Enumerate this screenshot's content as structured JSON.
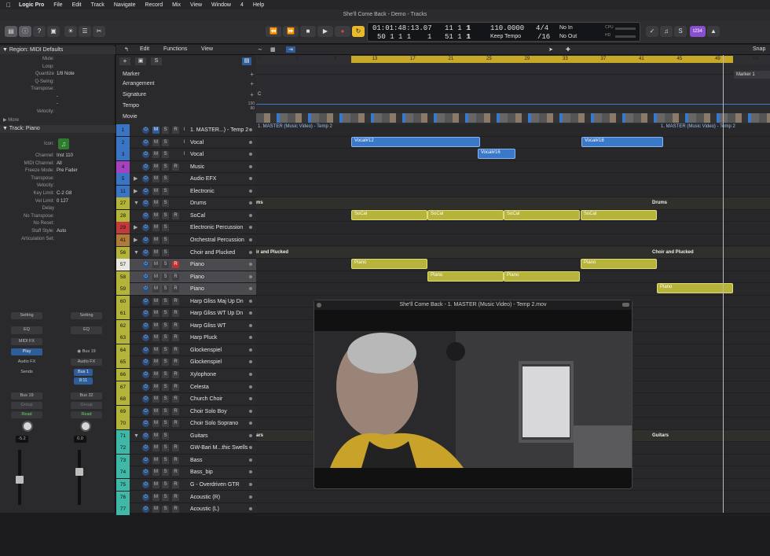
{
  "menubar": {
    "app": "Logic Pro",
    "items": [
      "File",
      "Edit",
      "Track",
      "Navigate",
      "Record",
      "Mix",
      "View",
      "Window",
      "4",
      "Help"
    ]
  },
  "window_title": "She'll Come Back - Demo - Tracks",
  "lcd": {
    "time": "01:01:48:13.07",
    "bars": "50 1 1 1",
    "sub1": "1",
    "pos2": "11 1 1",
    "sub2": "1",
    "pos3": "51 1 1",
    "sub3": "1",
    "tempo": "110.0000",
    "tempo_mode": "Keep Tempo",
    "sig": "4/4",
    "div": "/16",
    "in": "No In",
    "out": "No Out",
    "cpu": "CPU",
    "hd": "HD"
  },
  "toolbar": {
    "user": "t234"
  },
  "inspector": {
    "region_header": "Region: MIDI Defaults",
    "region_rows": [
      {
        "k": "Mute:",
        "v": ""
      },
      {
        "k": "Loop:",
        "v": ""
      },
      {
        "k": "Quantize",
        "v": "1/8 Note"
      },
      {
        "k": "Q-Swing:",
        "v": ""
      },
      {
        "k": "Transpose:",
        "v": ""
      },
      {
        "k": "",
        "v": "-"
      },
      {
        "k": "",
        "v": "-"
      },
      {
        "k": "Velocity:",
        "v": ""
      }
    ],
    "more": "More",
    "track_header": "Track:",
    "track_name": "Piano",
    "track_rows": [
      {
        "k": "Icon:",
        "v": ""
      },
      {
        "k": "Channel:",
        "v": "Inst 110"
      },
      {
        "k": "MIDI Channel:",
        "v": "All"
      },
      {
        "k": "Freeze Mode:",
        "v": "Pre Fader"
      },
      {
        "k": "Transpose:",
        "v": ""
      },
      {
        "k": "Velocity:",
        "v": ""
      },
      {
        "k": "Key Limit:",
        "v": "C-2  G8"
      },
      {
        "k": "Vel Limit:",
        "v": "0  127"
      },
      {
        "k": "Delay",
        "v": ""
      },
      {
        "k": "No Transpose:",
        "v": ""
      },
      {
        "k": "No Reset:",
        "v": ""
      },
      {
        "k": "Staff Style:",
        "v": "Auto"
      },
      {
        "k": "Articulation Set:",
        "v": ""
      }
    ],
    "strip1": {
      "setting": "Setting",
      "eq": "EQ",
      "midifx": "MIDI FX",
      "play": "Play",
      "audiofx": "Audio FX",
      "sends": "Sends",
      "output": "Bus 19",
      "group": "Group",
      "read": "Read",
      "vol": "-5.2"
    },
    "strip2": {
      "setting": "Setting",
      "eq": "EQ",
      "bus": "Bus 19",
      "audiofx": "Audio FX",
      "send1": "Bus 1",
      "send2": "8:11",
      "output": "Bus 32",
      "group": "Group",
      "read": "Read",
      "vol": "0.0"
    }
  },
  "tracks_menu": {
    "edit": "Edit",
    "functions": "Functions",
    "view": "View",
    "snap": "Snap"
  },
  "global_tracks": [
    "Marker",
    "Arrangement",
    "Signature",
    "Tempo",
    "Movie"
  ],
  "tempo_vals": [
    "130",
    "90"
  ],
  "signature_val": "C",
  "marker_label": "Marker 1",
  "ruler": [
    "1",
    "5",
    "9",
    "13",
    "17",
    "21",
    "25",
    "29",
    "33",
    "37",
    "41",
    "45",
    "49",
    "53"
  ],
  "tracks": [
    {
      "n": "1",
      "name": "1. MASTER...) - Temp 2",
      "color": "#3a74c4",
      "type": "video"
    },
    {
      "n": "2",
      "name": "Vocal",
      "color": "#3a74c4"
    },
    {
      "n": "3",
      "name": "Vocal",
      "color": "#3a74c4"
    },
    {
      "n": "4",
      "name": "Music",
      "color": "#a442c0"
    },
    {
      "n": "5",
      "name": "Audio EFX",
      "color": "#3a74c4",
      "folder": true
    },
    {
      "n": "11",
      "name": "Electronic",
      "color": "#3a74c4",
      "folder": true
    },
    {
      "n": "27",
      "name": "Drums",
      "color": "#b4b33a",
      "folder": true,
      "open": true
    },
    {
      "n": "28",
      "name": "SoCal",
      "color": "#b4b33a"
    },
    {
      "n": "29",
      "name": "Electronic Percussion",
      "color": "#c33a3a",
      "folder": true
    },
    {
      "n": "41",
      "name": "Orchestral Percussion",
      "color": "#b07a38",
      "folder": true
    },
    {
      "n": "56",
      "name": "Choir and Plucked",
      "color": "#b4b33a",
      "folder": true,
      "open": true
    },
    {
      "n": "57",
      "name": "Piano",
      "color": "#e8e8e0",
      "sel": true,
      "rec": true
    },
    {
      "n": "58",
      "name": "Piano",
      "color": "#b4b33a",
      "sel": true
    },
    {
      "n": "59",
      "name": "Piano",
      "color": "#b4b33a",
      "sel": true
    },
    {
      "n": "60",
      "name": "Harp Gliss Maj Up Dn",
      "color": "#b4b33a"
    },
    {
      "n": "61",
      "name": "Harp Gliss WT Up Dn",
      "color": "#b4b33a"
    },
    {
      "n": "62",
      "name": "Harp Gliss WT",
      "color": "#b4b33a"
    },
    {
      "n": "63",
      "name": "Harp Pluck",
      "color": "#b4b33a"
    },
    {
      "n": "64",
      "name": "Glockenspiel",
      "color": "#b4b33a"
    },
    {
      "n": "65",
      "name": "Glockenspiel",
      "color": "#b4b33a"
    },
    {
      "n": "66",
      "name": "Xylophone",
      "color": "#b4b33a"
    },
    {
      "n": "67",
      "name": "Celesta",
      "color": "#b4b33a"
    },
    {
      "n": "68",
      "name": "Church Choir",
      "color": "#b4b33a"
    },
    {
      "n": "69",
      "name": "Choir Solo Boy",
      "color": "#b4b33a"
    },
    {
      "n": "70",
      "name": "Choir Solo Soprano",
      "color": "#b4b33a"
    },
    {
      "n": "71",
      "name": "Guitars",
      "color": "#3fb8a8",
      "folder": true,
      "open": true
    },
    {
      "n": "72",
      "name": "GW-Bari M...thic Swells",
      "color": "#3fb8a8"
    },
    {
      "n": "73",
      "name": "Bass",
      "color": "#3fb8a8"
    },
    {
      "n": "74",
      "name": "Bass_bip",
      "color": "#3fb8a8"
    },
    {
      "n": "75",
      "name": "G - Overdriven GTR",
      "color": "#3fb8a8"
    },
    {
      "n": "76",
      "name": "Acoustic (R)",
      "color": "#3fb8a8"
    },
    {
      "n": "77",
      "name": "Acoustic (L)",
      "color": "#3fb8a8"
    }
  ],
  "regions": {
    "video": "1. MASTER (Music Video) - Temp 2",
    "video2": "1. MASTER (Music Video) - Temp 2",
    "vocal12": "Vocal#12",
    "vocal16": "Vocal#16",
    "vocal18": "Vocal#18",
    "socal": "SoCal",
    "piano": "Piano",
    "drums_folder": "Drums",
    "drums_folder_left": "ms",
    "choir_folder": "Choir and Plucked",
    "choir_folder_left": "ir and Plucked",
    "guitars_folder": "Guitars",
    "guitars_folder_left": "ars"
  },
  "movie_title": "She'll Come Back - 1. MASTER (Music Video) - Temp 2.mov"
}
